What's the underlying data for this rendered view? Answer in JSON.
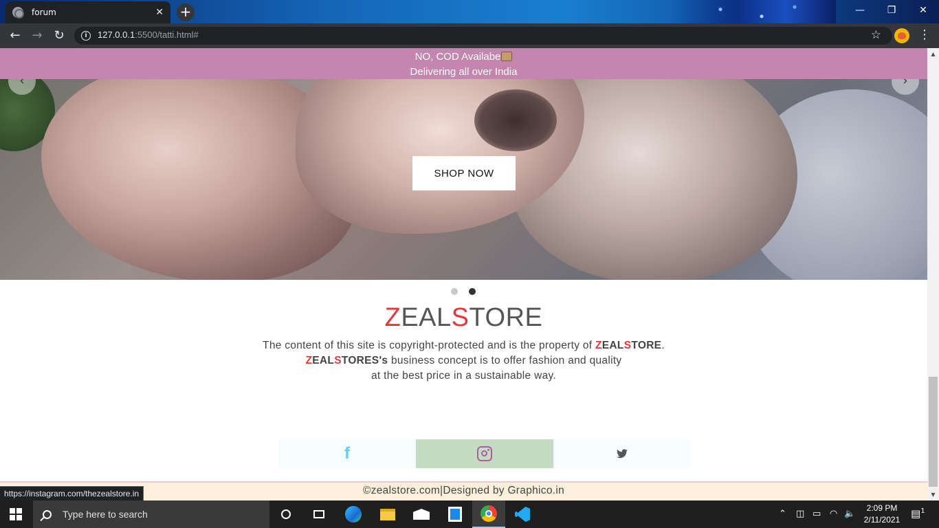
{
  "browser": {
    "tab_title": "forum",
    "tab_close": "✕",
    "new_tab": "+",
    "url_host": "127.0.0.1",
    "url_rest": ":5500/tatti.html#",
    "win_min": "—",
    "win_restore": "❐",
    "win_close": "✕"
  },
  "page": {
    "banner_line1": "NO, COD Availabe",
    "banner_line2": "Delivering all over India",
    "shop_button": "SHOP NOW",
    "carousel_prev": "‹",
    "carousel_next": "›",
    "brand_z": "Z",
    "brand_eal": "EAL",
    "brand_s": "S",
    "brand_tore": "TORE",
    "about_line1_pre": "The content of this site is copyright-protected and is the property of",
    "about_line2_post": "business concept is to offer fashion and quality",
    "about_line3": "at the best price in a sustainable way.",
    "brand_possessive": "TORES's",
    "footer_text": "©zealstore.com|Designed by Graphico.in",
    "status_url": "https://instagram.com/thezealstore.in"
  },
  "social": {
    "facebook_glyph": "f",
    "twitter_glyph": "🐦"
  },
  "taskbar": {
    "search_placeholder": "Type here to search",
    "time": "2:09 PM",
    "date": "2/11/2021",
    "notification_count": "1"
  },
  "colors": {
    "banner": "#c485ae",
    "brand_accent": "#e2373f",
    "instagram_bg": "#c4dcc4",
    "footer_bg": "#fdf0db"
  }
}
